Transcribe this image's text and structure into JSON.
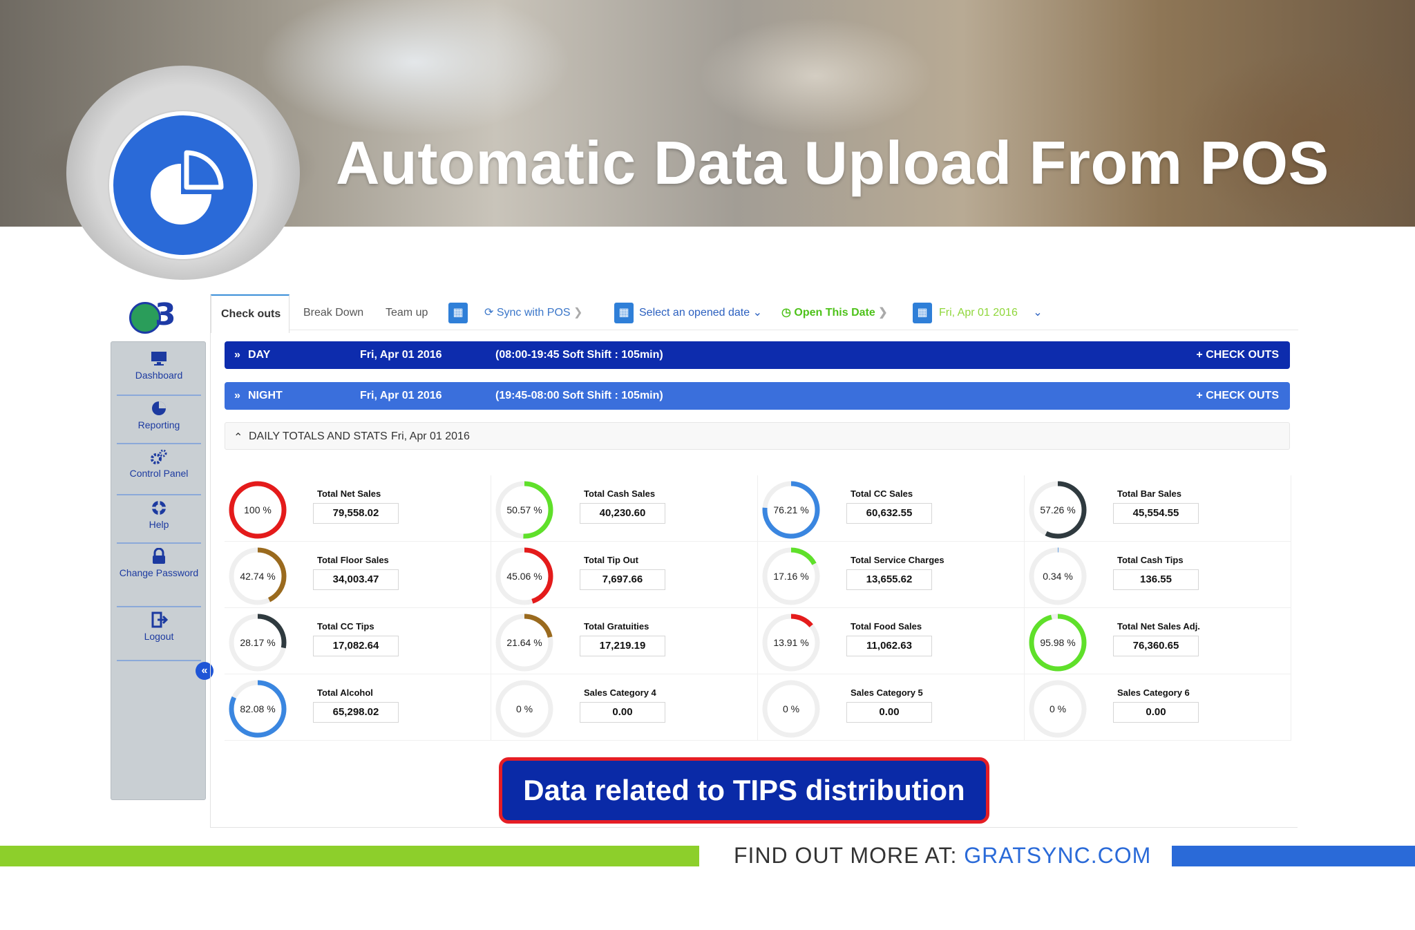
{
  "banner": {
    "title": "Automatic Data Upload From POS"
  },
  "brand": {
    "text": "3"
  },
  "sidebar": {
    "items": [
      {
        "label": "Dashboard",
        "icon": "monitor-icon"
      },
      {
        "label": "Reporting",
        "icon": "pie-chart-icon"
      },
      {
        "label": "Control Panel",
        "icon": "gears-icon"
      },
      {
        "label": "Help",
        "icon": "lifebuoy-icon"
      },
      {
        "label": "Change Password",
        "icon": "lock-icon"
      },
      {
        "label": "Logout",
        "icon": "logout-icon"
      }
    ],
    "collapse": "«"
  },
  "toolbar": {
    "tabs": [
      "Check outs",
      "Break Down",
      "Team up"
    ],
    "sync": "Sync with POS",
    "select_date": "Select an opened date",
    "open_date": "Open This Date",
    "current_date": "Fri, Apr 01 2016"
  },
  "shifts": {
    "day": {
      "name": "DAY",
      "date": "Fri, Apr 01 2016",
      "hours": "(08:00-19:45  Soft Shift : 105min)",
      "action": "+ CHECK OUTS",
      "color": "#0d2cad"
    },
    "night": {
      "name": "NIGHT",
      "date": "Fri, Apr 01 2016",
      "hours": "(19:45-08:00  Soft Shift : 105min)",
      "action": "+ CHECK OUTS",
      "color": "#3a6fdc"
    }
  },
  "daily": {
    "title": "DAILY TOTALS AND STATS",
    "date": "Fri, Apr 01 2016"
  },
  "stats": [
    {
      "label": "Total Net Sales",
      "value": "79,558.02",
      "pct": 100,
      "pct_text": "100 %",
      "color": "#e41b1b"
    },
    {
      "label": "Total Cash Sales",
      "value": "40,230.60",
      "pct": 50.57,
      "pct_text": "50.57 %",
      "color": "#5fe02a"
    },
    {
      "label": "Total CC Sales",
      "value": "60,632.55",
      "pct": 76.21,
      "pct_text": "76.21 %",
      "color": "#3a86e0"
    },
    {
      "label": "Total Bar Sales",
      "value": "45,554.55",
      "pct": 57.26,
      "pct_text": "57.26 %",
      "color": "#2f3a3f"
    },
    {
      "label": "Total Floor Sales",
      "value": "34,003.47",
      "pct": 42.74,
      "pct_text": "42.74 %",
      "color": "#9a6a1e"
    },
    {
      "label": "Total Tip Out",
      "value": "7,697.66",
      "pct": 45.06,
      "pct_text": "45.06 %",
      "color": "#e41b1b"
    },
    {
      "label": "Total Service Charges",
      "value": "13,655.62",
      "pct": 17.16,
      "pct_text": "17.16 %",
      "color": "#5fe02a"
    },
    {
      "label": "Total Cash Tips",
      "value": "136.55",
      "pct": 0.34,
      "pct_text": "0.34 %",
      "color": "#3a86e0"
    },
    {
      "label": "Total CC Tips",
      "value": "17,082.64",
      "pct": 28.17,
      "pct_text": "28.17 %",
      "color": "#2f3a3f"
    },
    {
      "label": "Total Gratuities",
      "value": "17,219.19",
      "pct": 21.64,
      "pct_text": "21.64 %",
      "color": "#9a6a1e"
    },
    {
      "label": "Total Food Sales",
      "value": "11,062.63",
      "pct": 13.91,
      "pct_text": "13.91 %",
      "color": "#e41b1b"
    },
    {
      "label": "Total Net Sales Adj.",
      "value": "76,360.65",
      "pct": 95.98,
      "pct_text": "95.98 %",
      "color": "#5fe02a"
    },
    {
      "label": "Total Alcohol",
      "value": "65,298.02",
      "pct": 82.08,
      "pct_text": "82.08 %",
      "color": "#3a86e0"
    },
    {
      "label": "Sales Category 4",
      "value": "0.00",
      "pct": 0,
      "pct_text": "0 %",
      "color": "#2f3a3f"
    },
    {
      "label": "Sales Category 5",
      "value": "0.00",
      "pct": 0,
      "pct_text": "0 %",
      "color": "#9a6a1e"
    },
    {
      "label": "Sales Category 6",
      "value": "0.00",
      "pct": 0,
      "pct_text": "0 %",
      "color": "#e41b1b"
    }
  ],
  "callout": "Data related to TIPS distribution",
  "footer": {
    "prefix": "FIND OUT MORE AT:",
    "url": "GRATSYNC.COM"
  }
}
